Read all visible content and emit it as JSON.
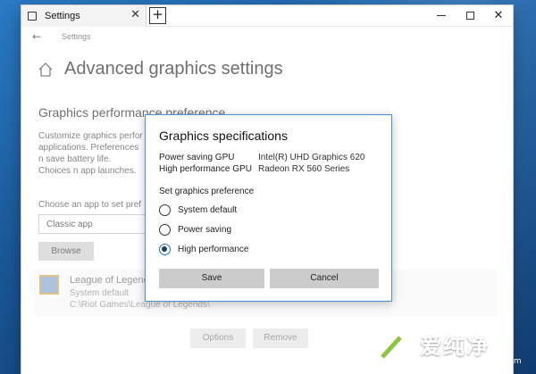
{
  "window": {
    "tab_title": "Settings",
    "new_tab_symbol": "+",
    "close_symbol": "✕",
    "minimize_symbol": "",
    "maximize_symbol": ""
  },
  "nav": {
    "back_symbol": "←",
    "title": "Settings"
  },
  "page": {
    "title": "Advanced graphics settings",
    "section_title": "Graphics performance preference",
    "description": "Customize graphics perfor applications. Preferences n save battery life. Choices n app launches.",
    "choose_label": "Choose an app to set pref",
    "app_select_value": "Classic app",
    "browse_label": "Browse"
  },
  "app_list": [
    {
      "name": "League of Legends",
      "status": "System default",
      "path": "C:\\Riot Games\\League of Legends\\"
    }
  ],
  "app_buttons": {
    "options_label": "Options",
    "remove_label": "Remove"
  },
  "dialog": {
    "title": "Graphics specifications",
    "specs": [
      {
        "key": "Power saving GPU",
        "value": "Intel(R) UHD Graphics 620"
      },
      {
        "key": "High performance GPU",
        "value": "Radeon RX 560 Series"
      }
    ],
    "preference_label": "Set graphics preference",
    "options": [
      {
        "label": "System default",
        "checked": false
      },
      {
        "label": "Power saving",
        "checked": false
      },
      {
        "label": "High performance",
        "checked": true
      }
    ],
    "save_label": "Save",
    "cancel_label": "Cancel"
  },
  "watermark": {
    "brand": "爱纯净",
    "url": "www.aichunjing.com"
  },
  "colors": {
    "accent": "#1d6fc9",
    "dialog_border": "#4a8fd6",
    "button_bg": "#cccccc"
  },
  "icons": {
    "tab": "window-icon",
    "home": "home-icon",
    "back": "back-arrow-icon",
    "app": "league-of-legends-icon",
    "watermark": "aichunjing-logo"
  }
}
